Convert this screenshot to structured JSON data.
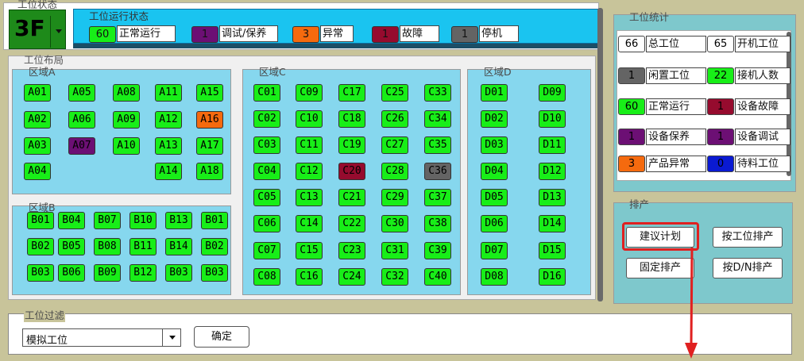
{
  "colors": {
    "green": "#18ee18",
    "purple": "#6c0f74",
    "orange": "#f56a0e",
    "maroon": "#960b2e",
    "gray": "#646464",
    "blue": "#0a1ad2",
    "accent": "#1ac4f0",
    "teal": "#7ec8cc"
  },
  "titlebar": {
    "group_label": "工位状态",
    "floor_button": "3F",
    "floor_dropdown_icon": "caret-down-icon"
  },
  "status": {
    "title": "工位运行状态",
    "items": [
      {
        "num": "60",
        "label": "正常运行",
        "color": "#18ee18"
      },
      {
        "num": "1",
        "label": "调试/保养",
        "color": "#6c0f74"
      },
      {
        "num": "3",
        "label": "异常",
        "color": "#f56a0e"
      },
      {
        "num": "1",
        "label": "故障",
        "color": "#960b2e"
      },
      {
        "num": "1",
        "label": "停机",
        "color": "#646464"
      }
    ]
  },
  "layout": {
    "title": "工位布局",
    "zones": {
      "A": {
        "label": "区域A",
        "cells": [
          "A01",
          "A05",
          "A08",
          "A11",
          "A15",
          "A02",
          "A06",
          "A09",
          "A12",
          "A16",
          "A03",
          "A07",
          "A10",
          "A13",
          "A17",
          "A04",
          "A14",
          "A18"
        ]
      },
      "B": {
        "label": "区域B",
        "cells": [
          "B01",
          "B04",
          "B07",
          "B10",
          "B13",
          "B01",
          "B02",
          "B05",
          "B08",
          "B11",
          "B14",
          "B02",
          "B03",
          "B06",
          "B09",
          "B12",
          "B03",
          "B03"
        ]
      },
      "C": {
        "label": "区域C",
        "cells": [
          "C01",
          "C09",
          "C17",
          "C25",
          "C33",
          "C02",
          "C10",
          "C18",
          "C26",
          "C34",
          "C03",
          "C11",
          "C19",
          "C27",
          "C35",
          "C04",
          "C12",
          "C20",
          "C28",
          "C36",
          "C05",
          "C13",
          "C21",
          "C29",
          "C37",
          "C06",
          "C14",
          "C22",
          "C30",
          "C38",
          "C07",
          "C15",
          "C23",
          "C31",
          "C39",
          "C08",
          "C16",
          "C24",
          "C32",
          "C40"
        ]
      },
      "D": {
        "label": "区域D",
        "cells": [
          "D01",
          "D09",
          "D02",
          "D10",
          "D03",
          "D11",
          "D04",
          "D12",
          "D05",
          "D13",
          "D06",
          "D14",
          "D07",
          "D15",
          "D08",
          "D16"
        ]
      }
    },
    "special": {
      "A07": "purple",
      "A16": "orange",
      "C20": "maroon",
      "C36": "gray"
    }
  },
  "stats": {
    "title": "工位统计",
    "items": [
      {
        "num": "66",
        "label": "总工位",
        "color": "#ffffff"
      },
      {
        "num": "65",
        "label": "开机工位",
        "color": "#ffffff"
      },
      {
        "num": "1",
        "label": "闲置工位",
        "color": "#646464"
      },
      {
        "num": "22",
        "label": "接机人数",
        "color": "#18ee18"
      },
      {
        "num": "60",
        "label": "正常运行",
        "color": "#18ee18"
      },
      {
        "num": "1",
        "label": "设备故障",
        "color": "#960b2e"
      },
      {
        "num": "1",
        "label": "设备保养",
        "color": "#6c0f74"
      },
      {
        "num": "1",
        "label": "设备调试",
        "color": "#6c0f74"
      },
      {
        "num": "3",
        "label": "产品异常",
        "color": "#f56a0e"
      },
      {
        "num": "0",
        "label": "待料工位",
        "color": "#0a1ad2"
      }
    ]
  },
  "schedule": {
    "title": "排产",
    "suggest_label": "建议计划",
    "by_station_label": "按工位排产",
    "fixed_label": "固定排产",
    "by_dn_label": "按D/N排产"
  },
  "filter": {
    "title": "工位过滤",
    "select_value": "模拟工位",
    "confirm_label": "确定"
  }
}
